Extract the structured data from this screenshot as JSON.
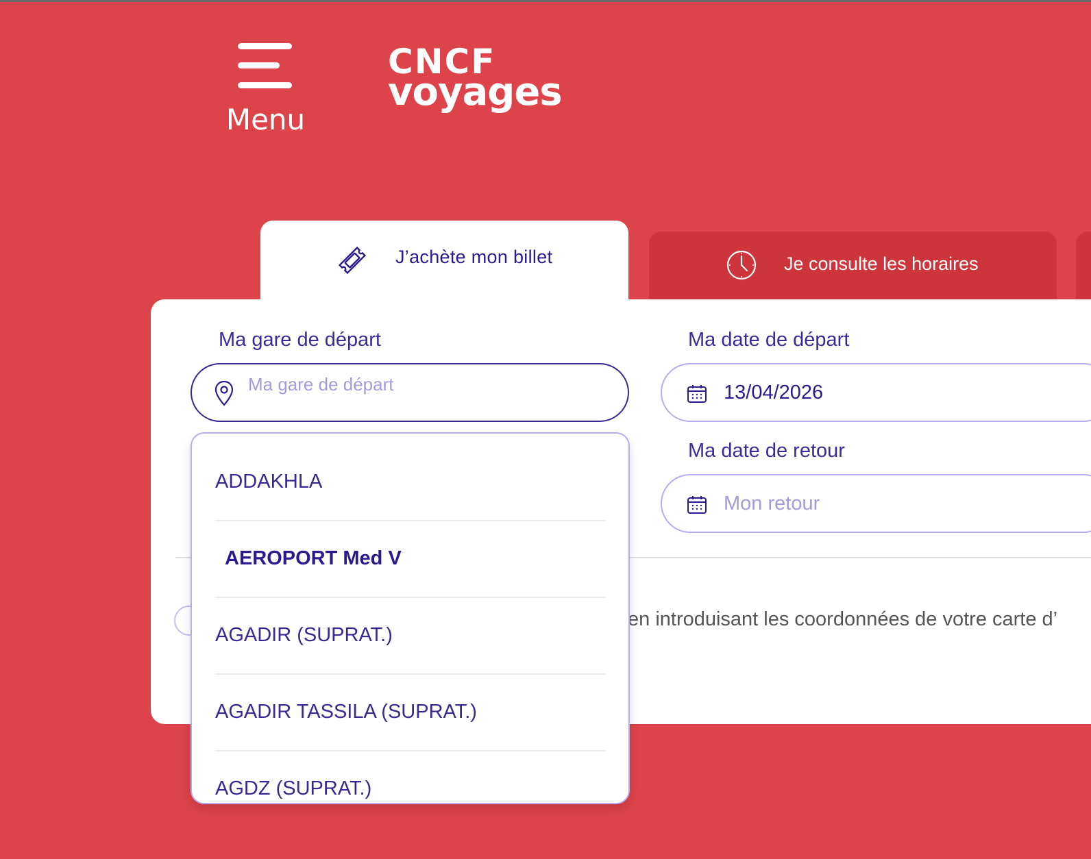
{
  "header": {
    "menu_label": "Menu",
    "logo_line1": "CNCF",
    "logo_line2": "voyages",
    "icons": [
      "menu-icon"
    ]
  },
  "tabs": [
    {
      "label": "J’achète mon billet",
      "icon": "ticket-icon",
      "active": true
    },
    {
      "label": "Je consulte les horaires",
      "icon": "clock-icon",
      "active": false
    }
  ],
  "form": {
    "departure_station": {
      "label": "Ma gare de départ",
      "placeholder": "Ma gare de départ",
      "value": "",
      "icon": "location-pin-icon"
    },
    "departure_date": {
      "label": "Ma date de départ",
      "value": "13/04/2026",
      "icon": "calendar-icon"
    },
    "return_date": {
      "label": "Ma date de retour",
      "placeholder": "Mon retour",
      "icon": "calendar-icon"
    }
  },
  "dropdown": {
    "items": [
      {
        "label": "ADDAKHLA"
      },
      {
        "label": "AEROPORT Med V"
      },
      {
        "label": "AGADIR (SUPRAT.)"
      },
      {
        "label": "AGADIR TASSILA (SUPRAT.)"
      },
      {
        "label": "AGDZ (SUPRAT.)"
      }
    ],
    "highlighted_index": 1
  },
  "info": {
    "text": "en introduisant les coordonnées de votre carte d’"
  },
  "colors": {
    "background": "#dc434a",
    "inactive_tab": "#cd343b",
    "primary_text": "#2a1a8f",
    "accent_border": "#3b2694",
    "soft_border": "#b9abee",
    "placeholder": "#a69bd9"
  }
}
